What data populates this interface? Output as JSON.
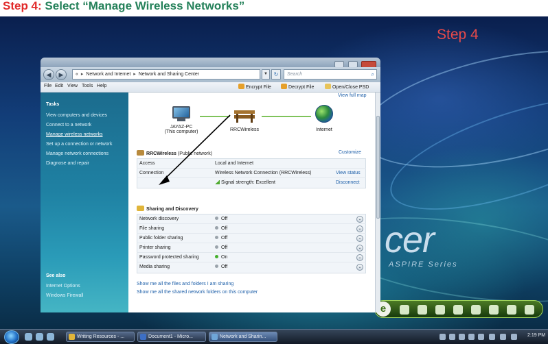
{
  "slide": {
    "step_label": "Step 4:",
    "step_text": "Select “Manage Wireless Networks”"
  },
  "desktop": {
    "step_badge": "Step 4",
    "brand_logo": "cer",
    "brand_series": "ASPIRE Series"
  },
  "window": {
    "breadcrumb": [
      "«",
      "Network and Internet",
      "Network and Sharing Center"
    ],
    "search_placeholder": "Search",
    "menu": [
      "File",
      "Edit",
      "View",
      "Tools",
      "Help"
    ],
    "toolbar": [
      "Encrypt File",
      "Decrypt File",
      "Open/Close PSD"
    ]
  },
  "sidebar": {
    "tasks_heading": "Tasks",
    "tasks": [
      "View computers and devices",
      "Connect to a network",
      "Manage wireless networks",
      "Set up a connection or network",
      "Manage network connections",
      "Diagnose and repair"
    ],
    "see_also_heading": "See also",
    "see_also": [
      "Internet Options",
      "Windows Firewall"
    ]
  },
  "network_map": {
    "view_full_map": "View full map",
    "computer_name": "JAYAZ-PC",
    "computer_sub": "(This computer)",
    "network_name": "RRCWireless",
    "internet": "Internet"
  },
  "network_details": {
    "title": "RRCWireless",
    "subtitle": "(Public network)",
    "customize": "Customize",
    "rows": [
      {
        "label": "Access",
        "value": "Local and Internet",
        "action": ""
      },
      {
        "label": "Connection",
        "value": "Wireless Network Connection (RRCWireless)",
        "action": "View status"
      },
      {
        "label": "",
        "value": "Signal strength:  Excellent",
        "action": "Disconnect"
      }
    ]
  },
  "sharing": {
    "title": "Sharing and Discovery",
    "rows": [
      {
        "label": "Network discovery",
        "value": "Off",
        "status_color": "#9aa3ab"
      },
      {
        "label": "File sharing",
        "value": "Off",
        "status_color": "#9aa3ab"
      },
      {
        "label": "Public folder sharing",
        "value": "Off",
        "status_color": "#9aa3ab"
      },
      {
        "label": "Printer sharing",
        "value": "Off",
        "status_color": "#9aa3ab"
      },
      {
        "label": "Password protected sharing",
        "value": "On",
        "status_color": "#44b02b"
      },
      {
        "label": "Media sharing",
        "value": "Off",
        "status_color": "#9aa3ab"
      }
    ],
    "links": [
      "Show me all the files and folders I am sharing",
      "Show me all the shared network folders on this computer"
    ]
  },
  "taskbar": {
    "buttons": [
      "Writing Resources - ...",
      "Document1 - Micro...",
      "Network and Sharin..."
    ],
    "clock": "2:19 PM"
  },
  "colors": {
    "title_red": "#e12a2a",
    "title_green": "#25815a",
    "link_blue": "#1c5ea8",
    "sidebar": "#1f81a3"
  }
}
